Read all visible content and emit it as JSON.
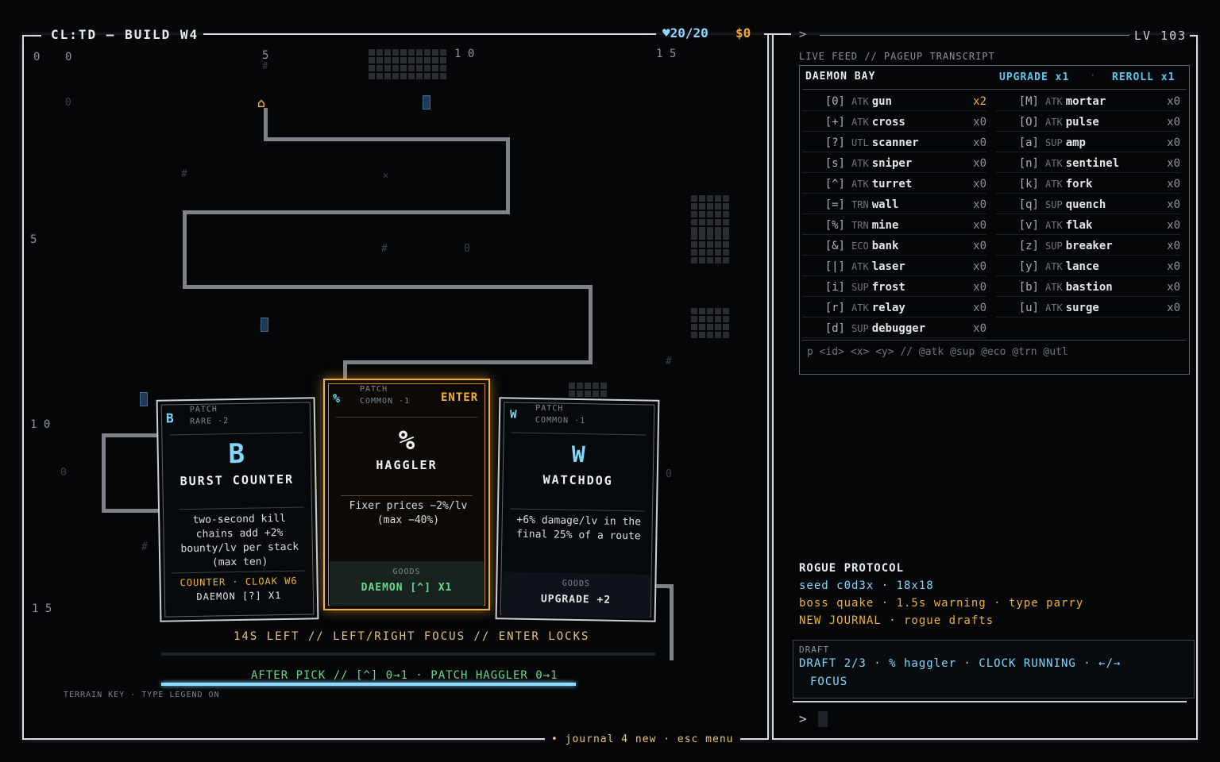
{
  "header": {
    "title": "CL:TD — BUILD W4",
    "hp": "♥20/20",
    "gold": "$0",
    "prompt_arrow": ">",
    "level": "LV 103"
  },
  "map": {
    "col_labels": [
      "0",
      "0",
      "5",
      "1 0",
      "1 5"
    ],
    "row_labels": [
      "5",
      "1 0",
      "1 5"
    ],
    "terrain_key": "TERRAIN KEY · TYPE LEGEND ON"
  },
  "cards": [
    {
      "kind": "PATCH",
      "rarity": "RARE ·2",
      "corner_glyph": "B",
      "big_glyph": "B",
      "name": "BURST COUNTER",
      "desc": "two-second kill chains add +2% bounty/lv per stack (max ten)",
      "foot1": "COUNTER · CLOAK W6",
      "foot2": "DAEMON [?] X1"
    },
    {
      "kind": "PATCH",
      "rarity": "COMMON ·1",
      "corner_glyph": "%",
      "big_glyph": "%",
      "enter": "ENTER",
      "name": "HAGGLER",
      "desc": "Fixer prices −2%/lv (max −40%)",
      "goods_label": "GOODS",
      "goods_value": "DAEMON [^] X1"
    },
    {
      "kind": "PATCH",
      "rarity": "COMMON ·1",
      "corner_glyph": "W",
      "big_glyph": "W",
      "name": "WATCHDOG",
      "desc": "+6% damage/lv in the final 25% of a route",
      "goods_label": "GOODS",
      "goods_value": "UPGRADE +2"
    }
  ],
  "pick": {
    "focus_line": "14S LEFT // LEFT/RIGHT FOCUS // ENTER LOCKS",
    "after_pick": "AFTER PICK // [^] 0→1 · PATCH HAGGLER 0→1",
    "timer_fraction": 0.84
  },
  "footer": {
    "journal": "• journal 4 new · esc menu"
  },
  "feed": {
    "header": "LIVE FEED // PAGEUP TRANSCRIPT"
  },
  "bay": {
    "title": "DAEMON BAY",
    "upgrade": "UPGRADE x1",
    "reroll": "REROLL x1",
    "left": [
      {
        "key": "[0]",
        "cat": "ATK",
        "name": "gun",
        "count": "x2",
        "hot": true
      },
      {
        "key": "[+]",
        "cat": "ATK",
        "name": "cross",
        "count": "x0"
      },
      {
        "key": "[?]",
        "cat": "UTL",
        "name": "scanner",
        "count": "x0"
      },
      {
        "key": "[s]",
        "cat": "ATK",
        "name": "sniper",
        "count": "x0"
      },
      {
        "key": "[^]",
        "cat": "ATK",
        "name": "turret",
        "count": "x0"
      },
      {
        "key": "[=]",
        "cat": "TRN",
        "name": "wall",
        "count": "x0"
      },
      {
        "key": "[%]",
        "cat": "TRN",
        "name": "mine",
        "count": "x0"
      },
      {
        "key": "[&]",
        "cat": "ECO",
        "name": "bank",
        "count": "x0"
      },
      {
        "key": "[|]",
        "cat": "ATK",
        "name": "laser",
        "count": "x0"
      },
      {
        "key": "[i]",
        "cat": "SUP",
        "name": "frost",
        "count": "x0"
      },
      {
        "key": "[r]",
        "cat": "ATK",
        "name": "relay",
        "count": "x0"
      },
      {
        "key": "[d]",
        "cat": "SUP",
        "name": "debugger",
        "count": "x0"
      }
    ],
    "right": [
      {
        "key": "[M]",
        "cat": "ATK",
        "name": "mortar",
        "count": "x0"
      },
      {
        "key": "[O]",
        "cat": "ATK",
        "name": "pulse",
        "count": "x0"
      },
      {
        "key": "[a]",
        "cat": "SUP",
        "name": "amp",
        "count": "x0"
      },
      {
        "key": "[n]",
        "cat": "ATK",
        "name": "sentinel",
        "count": "x0"
      },
      {
        "key": "[k]",
        "cat": "ATK",
        "name": "fork",
        "count": "x0"
      },
      {
        "key": "[q]",
        "cat": "SUP",
        "name": "quench",
        "count": "x0"
      },
      {
        "key": "[v]",
        "cat": "ATK",
        "name": "flak",
        "count": "x0"
      },
      {
        "key": "[z]",
        "cat": "SUP",
        "name": "breaker",
        "count": "x0"
      },
      {
        "key": "[y]",
        "cat": "ATK",
        "name": "lance",
        "count": "x0"
      },
      {
        "key": "[b]",
        "cat": "ATK",
        "name": "bastion",
        "count": "x0"
      },
      {
        "key": "[u]",
        "cat": "ATK",
        "name": "surge",
        "count": "x0"
      }
    ],
    "cmd_hint": "p <id> <x> <y> // @atk @sup @eco @trn @utl"
  },
  "rogue": {
    "title": "ROGUE PROTOCOL",
    "seed": "seed c0d3x · 18x18",
    "boss": "boss quake · 1.5s warning · type parry",
    "journal": "NEW JOURNAL · rogue drafts"
  },
  "draft": {
    "label": "DRAFT",
    "status": "DRAFT 2/3 · % haggler · CLOCK RUNNING · ←/→",
    "focus": "FOCUS"
  },
  "console": {
    "prompt": ">"
  },
  "colors": {
    "accent_cyan": "#7fd9ff",
    "accent_amber": "#f0b030",
    "accent_green": "#66d98e",
    "frame": "#d9dde2"
  }
}
